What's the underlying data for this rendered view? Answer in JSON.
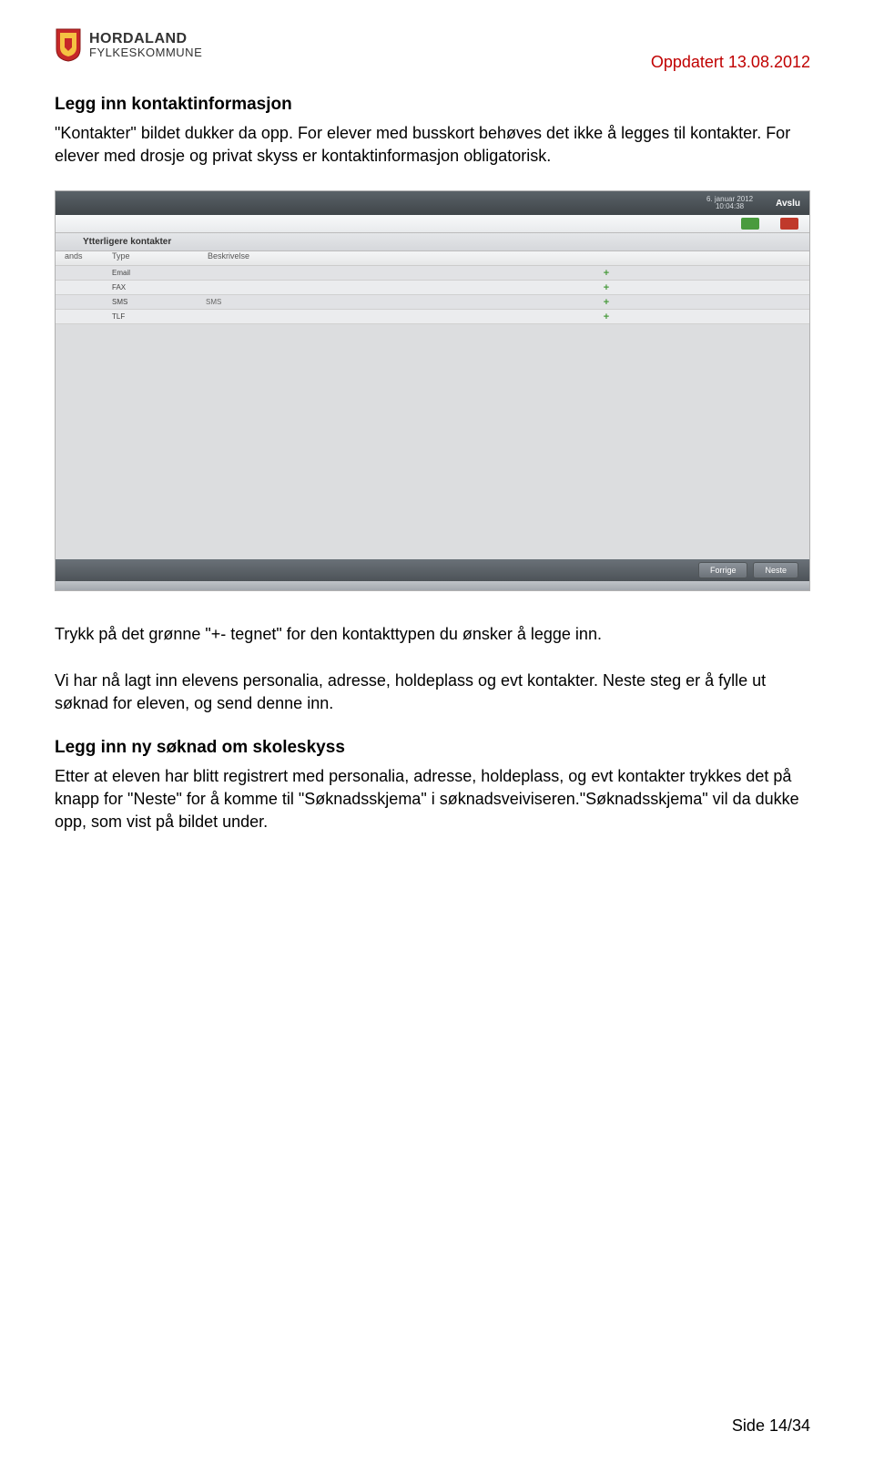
{
  "header": {
    "org_line1": "HORDALAND",
    "org_line2": "FYLKESKOMMUNE",
    "updated": "Oppdatert 13.08.2012"
  },
  "section1": {
    "title": "Legg inn kontaktinformasjon",
    "para": "\"Kontakter\" bildet dukker da opp. For elever med busskort behøves det ikke å legges til kontakter. For elever med drosje og privat skyss er kontaktinformasjon obligatorisk."
  },
  "screenshot": {
    "date_line1": "6. januar 2012",
    "date_line2": "10:04:38",
    "avslu": "Avslu",
    "subheader": "Ytterligere kontakter",
    "cols": {
      "c1": "ands",
      "c2": "Type",
      "c3": "Beskrivelse"
    },
    "rows": [
      {
        "type": "Email",
        "sms": ""
      },
      {
        "type": "FAX",
        "sms": ""
      },
      {
        "type": "SMS",
        "sms": "SMS"
      },
      {
        "type": "TLF",
        "sms": ""
      }
    ],
    "nav_prev": "Forrige",
    "nav_next": "Neste"
  },
  "para2": "Trykk på det grønne \"+- tegnet\" for den kontakttypen du ønsker å legge inn.",
  "para3": "Vi har nå lagt inn elevens personalia, adresse, holdeplass og evt kontakter. Neste steg er å fylle ut søknad for eleven, og send denne inn.",
  "section2": {
    "title": "Legg inn ny søknad om skoleskyss",
    "para": "Etter at eleven har blitt registrert med personalia, adresse, holdeplass, og evt kontakter trykkes det på knapp for \"Neste\" for å komme til \"Søknadsskjema\" i søknadsveiviseren.\"Søknadsskjema\" vil da dukke opp, som vist på bildet under."
  },
  "footer": "Side 14/34"
}
